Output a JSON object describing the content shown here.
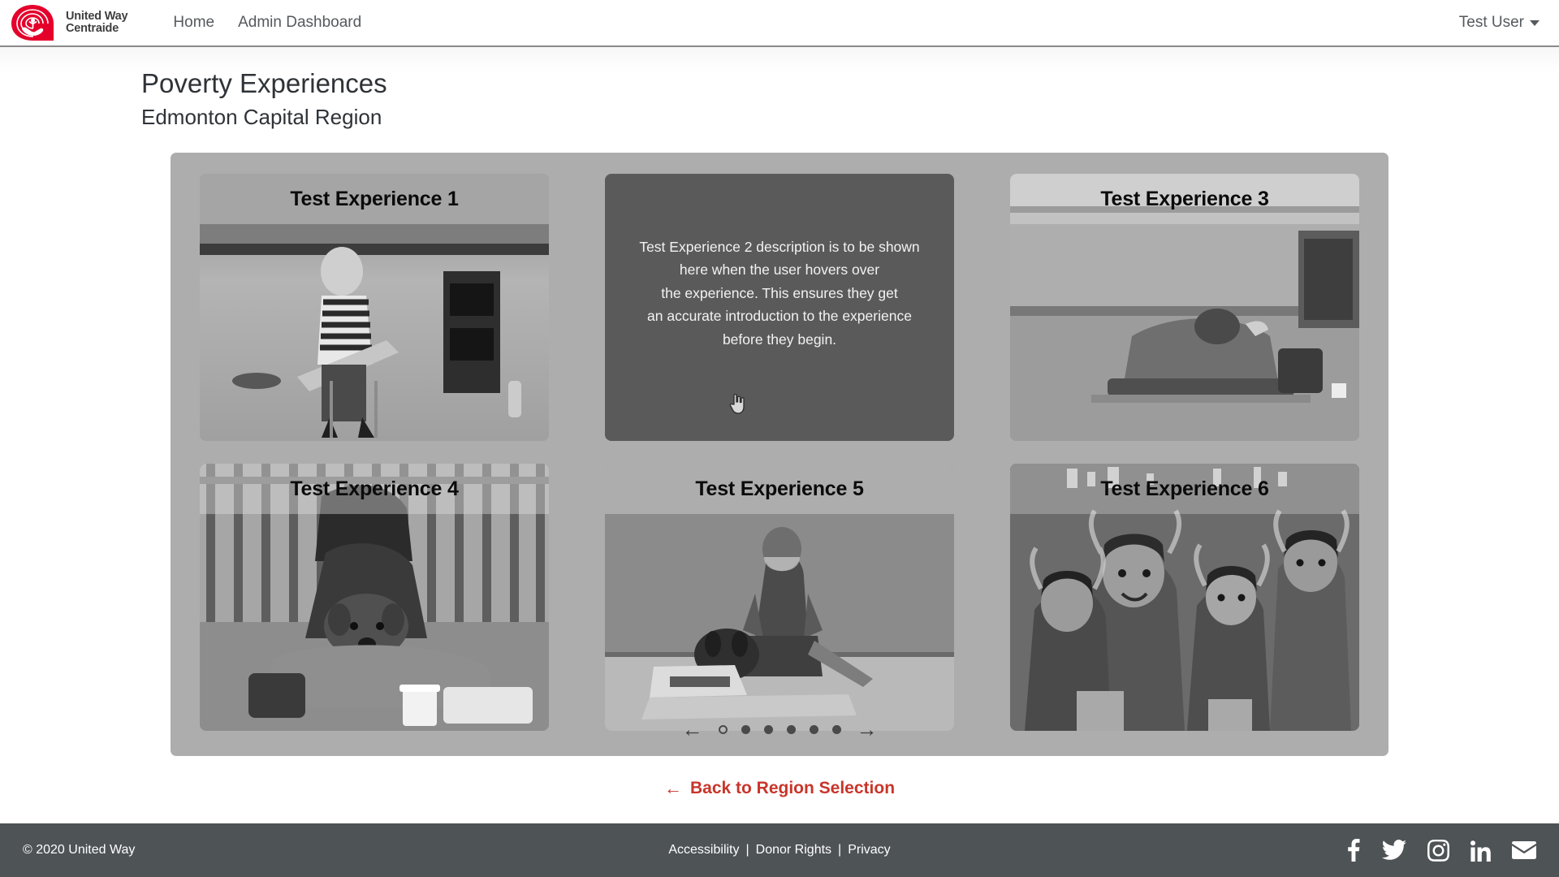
{
  "navbar": {
    "brand": {
      "line1": "United Way",
      "line2": "Centraide",
      "logo_icon": "united-way-logo"
    },
    "links": [
      {
        "label": "Home"
      },
      {
        "label": "Admin Dashboard"
      }
    ],
    "user_menu": {
      "label": "Test User",
      "caret_icon": "chevron-down-icon"
    }
  },
  "header": {
    "title": "Poverty Experiences",
    "subtitle": "Edmonton Capital Region"
  },
  "carousel": {
    "panel_color": "#adadad",
    "cards": [
      {
        "title": "Test Experience 1",
        "hovered": false,
        "description": ""
      },
      {
        "title": "Test Experience 2",
        "hovered": true,
        "description": "Test Experience 2 description is to be shown\nhere when the user hovers over\nthe experience. This ensures they get\nan accurate introduction to the experience\nbefore they begin."
      },
      {
        "title": "Test Experience 3",
        "hovered": false,
        "description": ""
      },
      {
        "title": "Test Experience 4",
        "hovered": false,
        "description": ""
      },
      {
        "title": "Test Experience 5",
        "hovered": false,
        "description": ""
      },
      {
        "title": "Test Experience 6",
        "hovered": false,
        "description": ""
      }
    ],
    "controls": {
      "prev_icon": "arrow-left-icon",
      "prev_label": "←",
      "next_icon": "arrow-right-icon",
      "next_label": "→",
      "dot_count": 6,
      "active_dot_index": 0
    }
  },
  "back_link": {
    "arrow": "←",
    "label": "Back to Region Selection",
    "color": "#c8352a"
  },
  "footer": {
    "copyright": "© 2020 United Way",
    "links": [
      {
        "label": "Accessibility"
      },
      {
        "label": "Donor Rights"
      },
      {
        "label": "Privacy"
      }
    ],
    "separator": "|",
    "socials": [
      {
        "name": "facebook-icon"
      },
      {
        "name": "twitter-icon"
      },
      {
        "name": "instagram-icon"
      },
      {
        "name": "linkedin-icon"
      },
      {
        "name": "email-icon"
      }
    ],
    "background": "#4e5356"
  },
  "cursor": {
    "type": "pointer-hand-cursor"
  }
}
